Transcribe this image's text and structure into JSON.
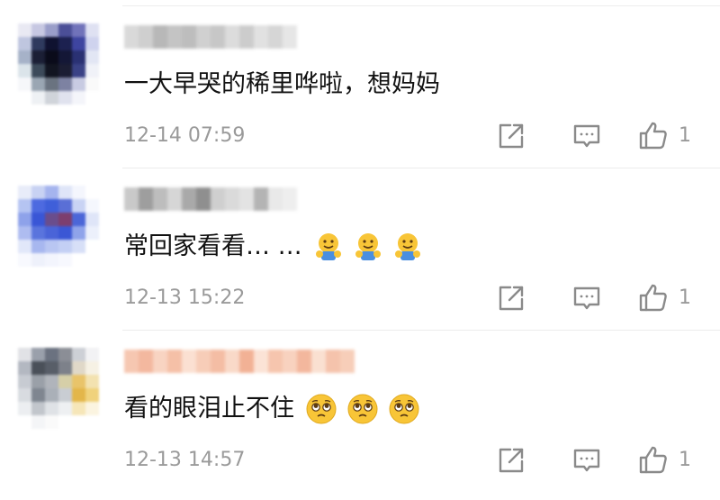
{
  "comments": [
    {
      "text": "一大早哭的稀里哗啦，想妈妈",
      "timestamp": "12-14 07:59",
      "likes": "1",
      "avatar_colors": [
        "#e9e9f3",
        "#c7c8e2",
        "#9a9ec9",
        "#4b4f97",
        "#7173ba",
        "#dfe1f2",
        "#bfc6df",
        "#2f3a5e",
        "#0f1230",
        "#1c2150",
        "#3e45a0",
        "#cfd3ee",
        "#a6b2c8",
        "#1b1f35",
        "#0a0b1a",
        "#141736",
        "#2a3173",
        "#e2e6f4",
        "#dbe4ea",
        "#3c4a5a",
        "#121521",
        "#1b1d33",
        "#3a4286",
        "#f0f2f8",
        "#f6f7fa",
        "#9aa6b3",
        "#6a7380",
        "#7d82a2",
        "#c8cbe2",
        "#fafafa",
        "#ffffff",
        "#eef1f4",
        "#d0d4da",
        "#e0e2ee",
        "#f4f5fa",
        "#ffffff"
      ],
      "username_colors": [
        "#d9d9d9",
        "#cfcfcf",
        "#b8b8b8",
        "#c4c4c4",
        "#bdbdbd",
        "#d0d0d0",
        "#c7c7c7",
        "#dcdcdc",
        "#cccccc",
        "#e1e1e1",
        "#d6d6d6",
        "#e6e6e6"
      ],
      "emojis": []
    },
    {
      "text": "常回家看看… …",
      "timestamp": "12-13 15:22",
      "likes": "1",
      "avatar_colors": [
        "#e8ecf9",
        "#c8d2f3",
        "#a5b4ee",
        "#dfe5f8",
        "#f4f6fd",
        "#ffffff",
        "#b5c4f2",
        "#4d6ae0",
        "#3f5fd9",
        "#5a6fd6",
        "#c9d3f4",
        "#f5f7fd",
        "#8ea2ea",
        "#3956d6",
        "#6a4d8c",
        "#7d3e6e",
        "#4b66d8",
        "#dfe5f8",
        "#aebcf0",
        "#5a74dd",
        "#4a64d8",
        "#3b57d5",
        "#8fa3ea",
        "#ecf0fb",
        "#e1e7f9",
        "#a7b7ef",
        "#b9c6f2",
        "#c3cff4",
        "#d7dff7",
        "#ffffff",
        "#f8f9fe",
        "#eef1fb",
        "#f3f5fd",
        "#f7f8fe",
        "#ffffff",
        "#ffffff"
      ],
      "username_colors": [
        "#c9c9c9",
        "#9e9e9e",
        "#bdbdbd",
        "#d6d6d6",
        "#a9a9a9",
        "#8f8f8f",
        "#cfcfcf",
        "#dadada",
        "#e3e3e3",
        "#b4b4b4",
        "#e9e9e9",
        "#eeeeee"
      ],
      "emojis": [
        "hugging-emoji",
        "hugging-emoji",
        "hugging-emoji"
      ]
    },
    {
      "text": "看的眼泪止不住",
      "timestamp": "12-13 14:57",
      "likes": "1",
      "avatar_colors": [
        "#e1e2e6",
        "#9aa0ab",
        "#6b7280",
        "#8b8e96",
        "#cdd0d6",
        "#f2f2f4",
        "#b3b8c1",
        "#4a5059",
        "#585e68",
        "#7d818a",
        "#e0d8c8",
        "#f6f1e4",
        "#c7cbd2",
        "#9aa0a8",
        "#b0b4bb",
        "#d6cfa8",
        "#e9c46a",
        "#f3e2b0",
        "#d8dbe0",
        "#7f8690",
        "#aab0b8",
        "#c9cdd3",
        "#e3b64a",
        "#f0d27c",
        "#eceef1",
        "#c2c6cc",
        "#dfe2e6",
        "#eef0f2",
        "#f6e6b8",
        "#fbf4e0",
        "#ffffff",
        "#f4f5f7",
        "#fafafa",
        "#ffffff",
        "#ffffff",
        "#ffffff"
      ],
      "username_colors": [
        "#f6c7b1",
        "#f3b89f",
        "#f8d4c2",
        "#f5c0a7",
        "#fbe0d2",
        "#f7cdb8",
        "#f4bda4",
        "#f9d9c8",
        "#f2b195",
        "#fbe3d6",
        "#f6c5ae",
        "#f8d2bf",
        "#f3b79d",
        "#fae0d1",
        "#f5c3ac",
        "#f7ceb9"
      ],
      "emojis": [
        "pleading-emoji",
        "pleading-emoji",
        "pleading-emoji"
      ]
    }
  ],
  "colors": {
    "text": "#111111",
    "meta": "#9a9a9a",
    "icon": "#8a8a8a",
    "divider": "#ececec"
  }
}
